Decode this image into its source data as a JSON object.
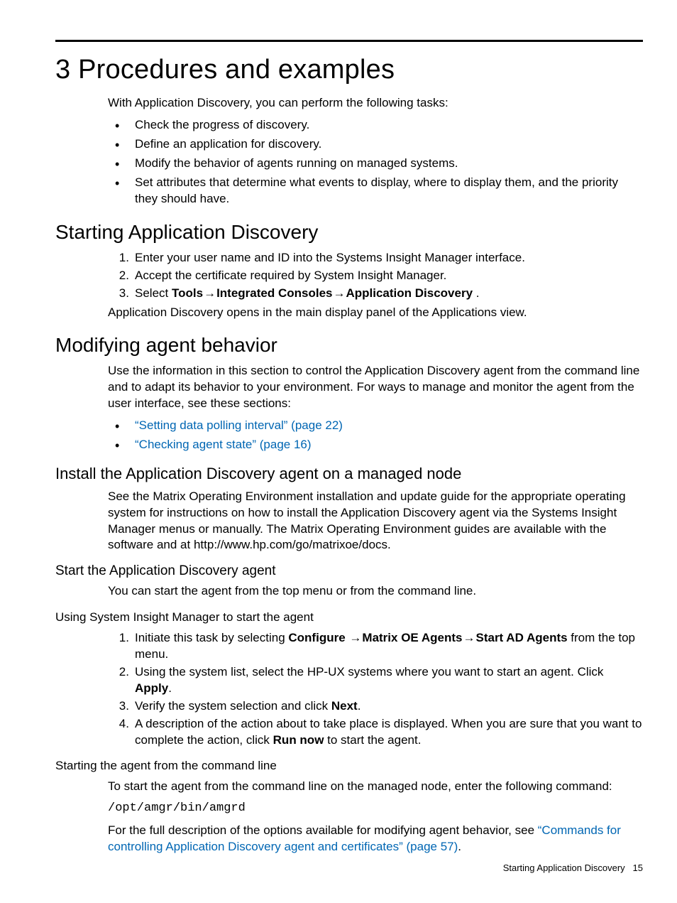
{
  "h1": "3 Procedures and examples",
  "intro": "With Application Discovery, you can perform the following tasks:",
  "intro_bullets": [
    "Check the progress of discovery.",
    "Define an application for discovery.",
    "Modify the behavior of agents running on managed systems.",
    "Set attributes that determine what events to display, where to display them, and the priority they should have."
  ],
  "h2_start": "Starting Application Discovery",
  "start_steps_1": "Enter your user name and ID into the Systems Insight Manager interface.",
  "start_steps_2": "Accept the certificate required by System Insight Manager.",
  "start_step3_select": "Select ",
  "start_step3_tools": "Tools",
  "start_step3_ic": "Integrated Consoles",
  "start_step3_ad": "Application Discovery",
  "start_step3_end": " .",
  "start_after": "Application Discovery opens in the main display panel of the  Applications view.",
  "h2_mod": "Modifying agent behavior",
  "mod_para": "Use the information in this section to control the Application Discovery agent from the command line and to adapt its behavior to your environment. For ways to manage and monitor the agent from the user interface, see these sections:",
  "mod_links": [
    "“Setting data polling interval” (page 22)",
    "“Checking agent state” (page 16)"
  ],
  "h3_install": "Install the Application Discovery agent on a managed node",
  "install_para": "See the Matrix Operating Environment installation and update guide for the appropriate operating system for instructions on how to install the Application Discovery agent via the Systems Insight Manager menus or manually. The Matrix Operating Environment guides are available with the software and at http://www.hp.com/go/matrixoe/docs.",
  "h4_start_agent": "Start the Application Discovery agent",
  "start_agent_para": "You can start the agent from the top menu or from the command line.",
  "h5_sim": "Using System Insight Manager to start the agent",
  "sim1_pre": "Initiate this task by selecting ",
  "sim1_configure": "Configure",
  "sim1_moe": "Matrix OE Agents",
  "sim1_sad": "Start AD Agents",
  "sim1_post": "  from the top menu.",
  "sim2_pre": "Using the system list, select the HP-UX systems where you want to start an agent. Click ",
  "sim2_apply": "Apply",
  "sim2_post": ".",
  "sim3_pre": "Verify the system selection and click ",
  "sim3_next": "Next",
  "sim3_post": ".",
  "sim4_pre": "A description of the action about to take place is displayed. When you are sure that you want to complete the action, click ",
  "sim4_run": "Run now",
  "sim4_post": " to start the agent.",
  "h5_cli": "Starting the agent from the command line",
  "cli_para": "To start the agent from the command line on the managed node, enter the following command:",
  "cli_cmd": "/opt/amgr/bin/amgrd",
  "cli_after_pre": "For the full description of the options available for modifying agent behavior, see ",
  "cli_after_link": "“Commands for controlling Application Discovery agent and certificates” (page 57)",
  "cli_after_post": ".",
  "arrow": "→",
  "footer_label": "Starting Application Discovery",
  "footer_page": "15"
}
